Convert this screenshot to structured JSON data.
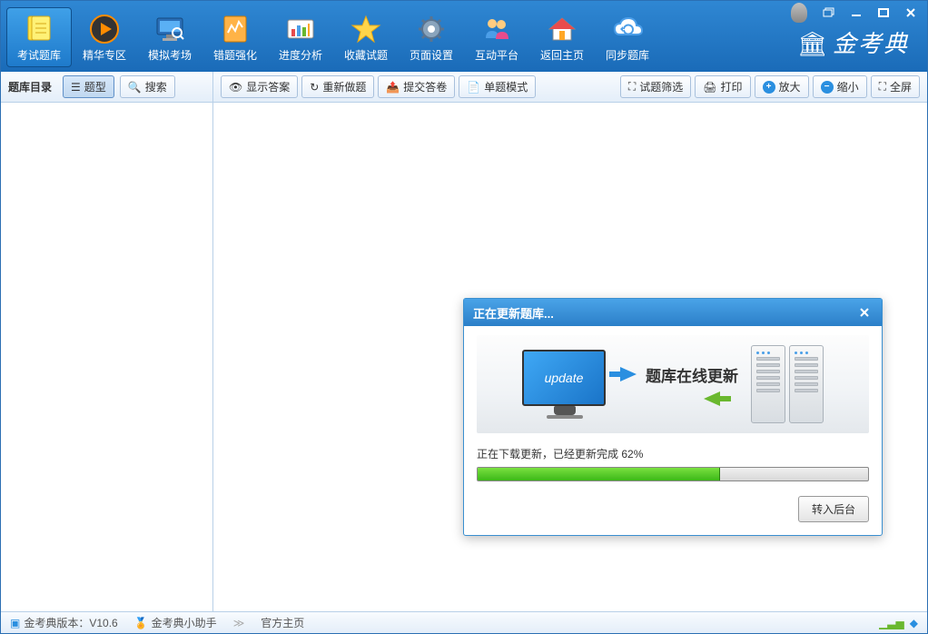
{
  "toolbar": {
    "items": [
      {
        "label": "考试题库",
        "icon": "exam-db"
      },
      {
        "label": "精华专区",
        "icon": "play"
      },
      {
        "label": "模拟考场",
        "icon": "sim-exam"
      },
      {
        "label": "错题强化",
        "icon": "wrong-q"
      },
      {
        "label": "进度分析",
        "icon": "progress"
      },
      {
        "label": "收藏试题",
        "icon": "favorite"
      },
      {
        "label": "页面设置",
        "icon": "settings"
      },
      {
        "label": "互动平台",
        "icon": "community"
      },
      {
        "label": "返回主页",
        "icon": "home"
      },
      {
        "label": "同步题库",
        "icon": "sync"
      }
    ],
    "brand": "金考典"
  },
  "sidebar": {
    "title": "题库目录",
    "btn_type": "题型",
    "btn_search": "搜索"
  },
  "actions": {
    "show_answer": "显示答案",
    "redo": "重新做题",
    "submit": "提交答卷",
    "single_mode": "单题模式",
    "filter": "试题筛选",
    "print": "打印",
    "zoom_in": "放大",
    "zoom_out": "缩小",
    "fullscreen": "全屏"
  },
  "modal": {
    "title": "正在更新题库...",
    "screen_text": "update",
    "center_text": "题库在线更新",
    "progress_prefix": "正在下载更新，已经更新完成 ",
    "progress_pct": "62%",
    "progress_value": 62,
    "btn_background": "转入后台"
  },
  "status": {
    "version": "金考典版本：V10.6",
    "helper": "金考典小助手",
    "official": "官方主页"
  }
}
